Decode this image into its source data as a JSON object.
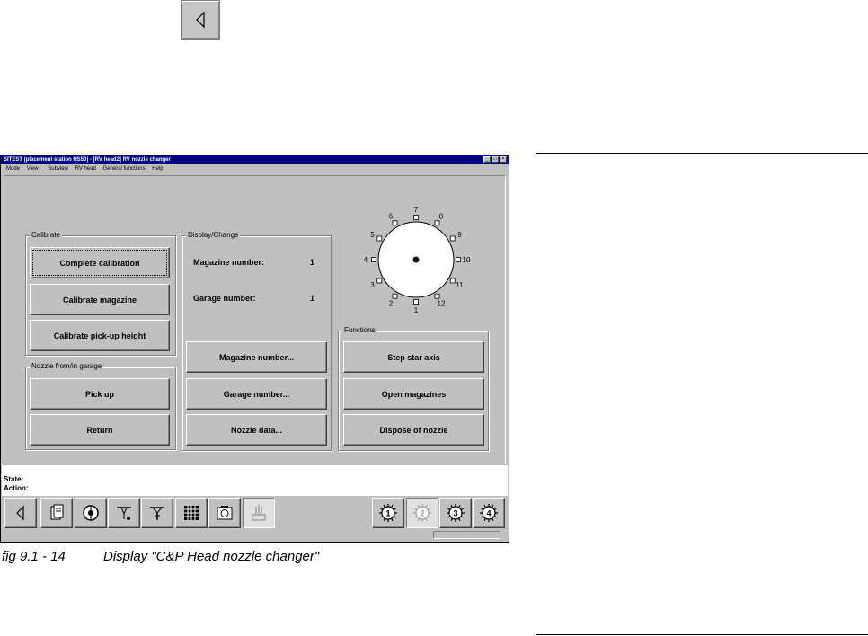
{
  "top_button": {
    "icon": "triangle-left-icon"
  },
  "window": {
    "title": "SITEST (placement station HS50) - [RV head2] RV nozzle changer",
    "title_buttons": [
      "_",
      "□",
      "×"
    ],
    "menu": [
      "Mode",
      "View",
      "Subview",
      "RV head",
      "General functions",
      "Help"
    ]
  },
  "calibrate": {
    "label": "Calibrate",
    "buttons": [
      "Complete calibration",
      "Calibrate magazine",
      "Calibrate pick-up height"
    ]
  },
  "nozzle_garage": {
    "label": "Nozzle from/in garage",
    "buttons": [
      "Pick up",
      "Return"
    ]
  },
  "display_change": {
    "label": "Display/Change",
    "magazine_label": "Magazine number:",
    "magazine_value": "1",
    "garage_label": "Garage number:",
    "garage_value": "1",
    "buttons": [
      "Magazine number...",
      "Garage number...",
      "Nozzle data..."
    ]
  },
  "functions": {
    "label": "Functions",
    "buttons": [
      "Step star axis",
      "Open magazines",
      "Dispose of nozzle"
    ]
  },
  "dial": {
    "positions": [
      "1",
      "2",
      "3",
      "4",
      "5",
      "6",
      "7",
      "8",
      "9",
      "10",
      "11",
      "12"
    ],
    "active_position": "1"
  },
  "status": {
    "state_label": "State:",
    "action_label": "Action:"
  },
  "toolbar": {
    "left_icons": [
      "back-icon",
      "document-icon",
      "nozzle-disc-icon",
      "pick-head-icon",
      "star-head-icon",
      "grid-icon",
      "camera-icon",
      "nozzle-changer-icon"
    ],
    "right_heads": [
      "1",
      "2",
      "3",
      "4"
    ],
    "pressed_left": "nozzle-changer-icon",
    "pressed_right": "2"
  },
  "caption": {
    "fig": "fig 9.1 - 14",
    "text": "Display \"C&P Head nozzle changer\""
  },
  "colors": {
    "titlebar": "#000080",
    "face": "#c0c0c0"
  }
}
